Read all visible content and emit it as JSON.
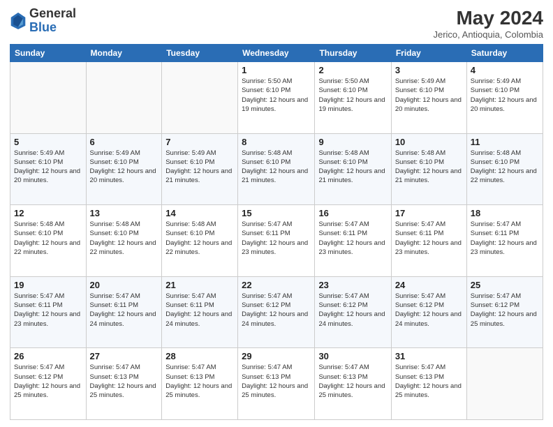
{
  "header": {
    "logo_line1": "General",
    "logo_line2": "Blue",
    "month_year": "May 2024",
    "location": "Jerico, Antioquia, Colombia"
  },
  "weekdays": [
    "Sunday",
    "Monday",
    "Tuesday",
    "Wednesday",
    "Thursday",
    "Friday",
    "Saturday"
  ],
  "weeks": [
    [
      {
        "day": "",
        "info": ""
      },
      {
        "day": "",
        "info": ""
      },
      {
        "day": "",
        "info": ""
      },
      {
        "day": "1",
        "info": "Sunrise: 5:50 AM\nSunset: 6:10 PM\nDaylight: 12 hours and 19 minutes."
      },
      {
        "day": "2",
        "info": "Sunrise: 5:50 AM\nSunset: 6:10 PM\nDaylight: 12 hours and 19 minutes."
      },
      {
        "day": "3",
        "info": "Sunrise: 5:49 AM\nSunset: 6:10 PM\nDaylight: 12 hours and 20 minutes."
      },
      {
        "day": "4",
        "info": "Sunrise: 5:49 AM\nSunset: 6:10 PM\nDaylight: 12 hours and 20 minutes."
      }
    ],
    [
      {
        "day": "5",
        "info": "Sunrise: 5:49 AM\nSunset: 6:10 PM\nDaylight: 12 hours and 20 minutes."
      },
      {
        "day": "6",
        "info": "Sunrise: 5:49 AM\nSunset: 6:10 PM\nDaylight: 12 hours and 20 minutes."
      },
      {
        "day": "7",
        "info": "Sunrise: 5:49 AM\nSunset: 6:10 PM\nDaylight: 12 hours and 21 minutes."
      },
      {
        "day": "8",
        "info": "Sunrise: 5:48 AM\nSunset: 6:10 PM\nDaylight: 12 hours and 21 minutes."
      },
      {
        "day": "9",
        "info": "Sunrise: 5:48 AM\nSunset: 6:10 PM\nDaylight: 12 hours and 21 minutes."
      },
      {
        "day": "10",
        "info": "Sunrise: 5:48 AM\nSunset: 6:10 PM\nDaylight: 12 hours and 21 minutes."
      },
      {
        "day": "11",
        "info": "Sunrise: 5:48 AM\nSunset: 6:10 PM\nDaylight: 12 hours and 22 minutes."
      }
    ],
    [
      {
        "day": "12",
        "info": "Sunrise: 5:48 AM\nSunset: 6:10 PM\nDaylight: 12 hours and 22 minutes."
      },
      {
        "day": "13",
        "info": "Sunrise: 5:48 AM\nSunset: 6:10 PM\nDaylight: 12 hours and 22 minutes."
      },
      {
        "day": "14",
        "info": "Sunrise: 5:48 AM\nSunset: 6:10 PM\nDaylight: 12 hours and 22 minutes."
      },
      {
        "day": "15",
        "info": "Sunrise: 5:47 AM\nSunset: 6:11 PM\nDaylight: 12 hours and 23 minutes."
      },
      {
        "day": "16",
        "info": "Sunrise: 5:47 AM\nSunset: 6:11 PM\nDaylight: 12 hours and 23 minutes."
      },
      {
        "day": "17",
        "info": "Sunrise: 5:47 AM\nSunset: 6:11 PM\nDaylight: 12 hours and 23 minutes."
      },
      {
        "day": "18",
        "info": "Sunrise: 5:47 AM\nSunset: 6:11 PM\nDaylight: 12 hours and 23 minutes."
      }
    ],
    [
      {
        "day": "19",
        "info": "Sunrise: 5:47 AM\nSunset: 6:11 PM\nDaylight: 12 hours and 23 minutes."
      },
      {
        "day": "20",
        "info": "Sunrise: 5:47 AM\nSunset: 6:11 PM\nDaylight: 12 hours and 24 minutes."
      },
      {
        "day": "21",
        "info": "Sunrise: 5:47 AM\nSunset: 6:11 PM\nDaylight: 12 hours and 24 minutes."
      },
      {
        "day": "22",
        "info": "Sunrise: 5:47 AM\nSunset: 6:12 PM\nDaylight: 12 hours and 24 minutes."
      },
      {
        "day": "23",
        "info": "Sunrise: 5:47 AM\nSunset: 6:12 PM\nDaylight: 12 hours and 24 minutes."
      },
      {
        "day": "24",
        "info": "Sunrise: 5:47 AM\nSunset: 6:12 PM\nDaylight: 12 hours and 24 minutes."
      },
      {
        "day": "25",
        "info": "Sunrise: 5:47 AM\nSunset: 6:12 PM\nDaylight: 12 hours and 25 minutes."
      }
    ],
    [
      {
        "day": "26",
        "info": "Sunrise: 5:47 AM\nSunset: 6:12 PM\nDaylight: 12 hours and 25 minutes."
      },
      {
        "day": "27",
        "info": "Sunrise: 5:47 AM\nSunset: 6:13 PM\nDaylight: 12 hours and 25 minutes."
      },
      {
        "day": "28",
        "info": "Sunrise: 5:47 AM\nSunset: 6:13 PM\nDaylight: 12 hours and 25 minutes."
      },
      {
        "day": "29",
        "info": "Sunrise: 5:47 AM\nSunset: 6:13 PM\nDaylight: 12 hours and 25 minutes."
      },
      {
        "day": "30",
        "info": "Sunrise: 5:47 AM\nSunset: 6:13 PM\nDaylight: 12 hours and 25 minutes."
      },
      {
        "day": "31",
        "info": "Sunrise: 5:47 AM\nSunset: 6:13 PM\nDaylight: 12 hours and 25 minutes."
      },
      {
        "day": "",
        "info": ""
      }
    ]
  ]
}
